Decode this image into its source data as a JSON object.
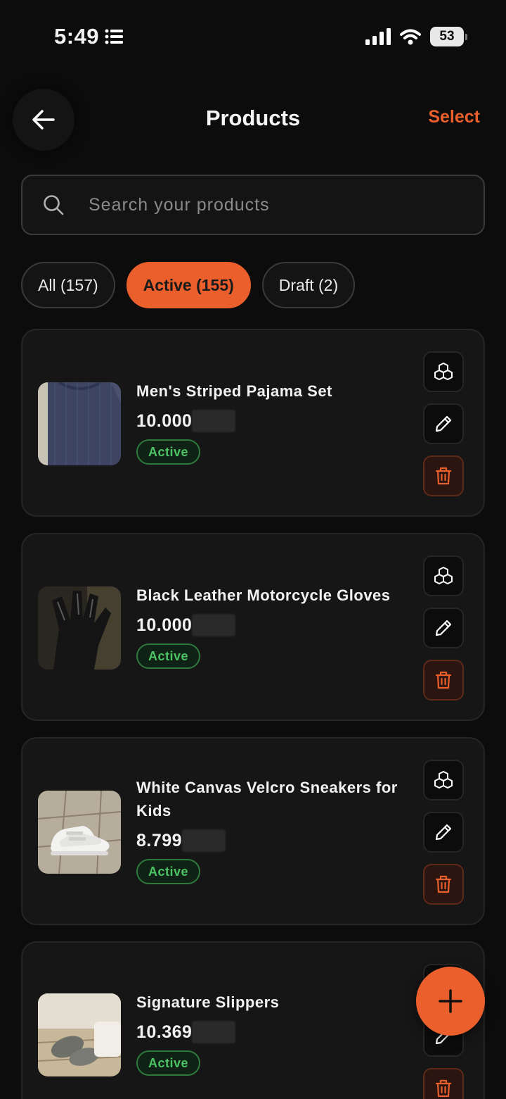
{
  "status_bar": {
    "time": "5:49",
    "battery": "53"
  },
  "header": {
    "title": "Products",
    "select_label": "Select"
  },
  "search": {
    "placeholder": "Search your products"
  },
  "filters": [
    {
      "label": "All (157)",
      "selected": false
    },
    {
      "label": "Active (155)",
      "selected": true
    },
    {
      "label": "Draft (2)",
      "selected": false
    }
  ],
  "products": [
    {
      "name": "Men's Striped Pajama Set",
      "price": "10.000",
      "status": "Active",
      "image": "navy-shirt"
    },
    {
      "name": "Black Leather Motorcycle Gloves",
      "price": "10.000",
      "status": "Active",
      "image": "black-gloves"
    },
    {
      "name": "White Canvas Velcro Sneakers for Kids",
      "price": "8.799",
      "status": "Active",
      "image": "white-sneakers"
    },
    {
      "name": "Signature Slippers",
      "price": "10.369",
      "status": "Active",
      "image": "grey-slippers"
    }
  ],
  "colors": {
    "accent": "#ea5f2c",
    "background": "#0c0c0c",
    "card": "#161616",
    "badge_text": "#4cc364"
  },
  "icons": [
    "back-arrow-icon",
    "search-icon",
    "cubes-icon",
    "pencil-icon",
    "trash-icon",
    "plus-icon"
  ]
}
